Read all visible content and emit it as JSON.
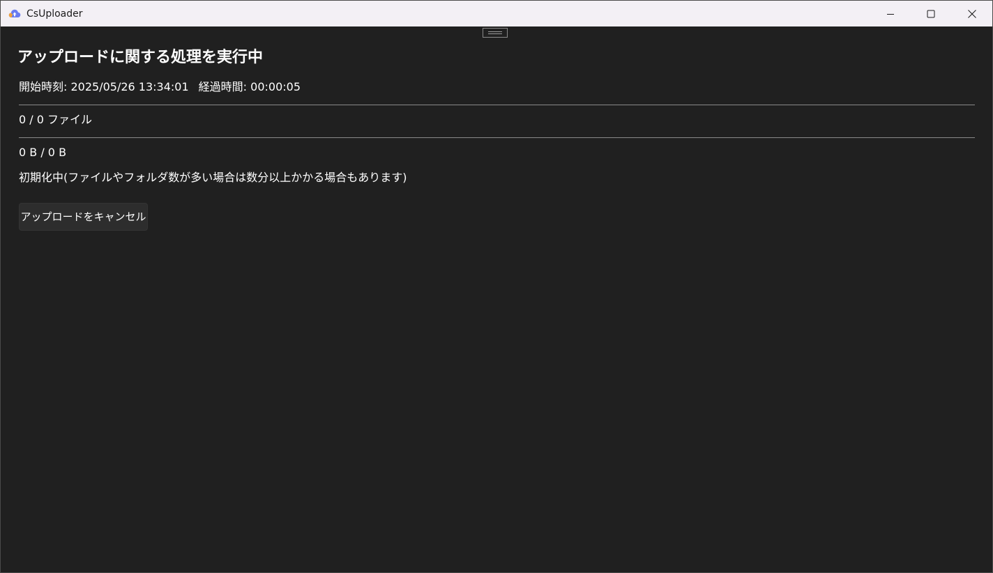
{
  "window": {
    "title": "CsUploader",
    "app_icon": "cloud-upload-icon",
    "controls": [
      "minimize-icon",
      "maximize-icon",
      "close-icon"
    ]
  },
  "main": {
    "heading": "アップロードに関する処理を実行中",
    "start_time": "開始時刻: 2025/05/26 13:34:01",
    "elapsed_time": "経過時間: 00:00:05",
    "file_count": "0 / 0 ファイル",
    "byte_count": "0 B / 0 B",
    "status": "初期化中(ファイルやフォルダ数が多い場合は数分以上かかる場合もあります)",
    "cancel_label": "アップロードをキャンセル"
  },
  "colors": {
    "background": "#202020",
    "titlebar": "#f3f0f5",
    "text": "#ffffff",
    "divider": "#8a8a8a",
    "button": "#2d2d2d"
  }
}
